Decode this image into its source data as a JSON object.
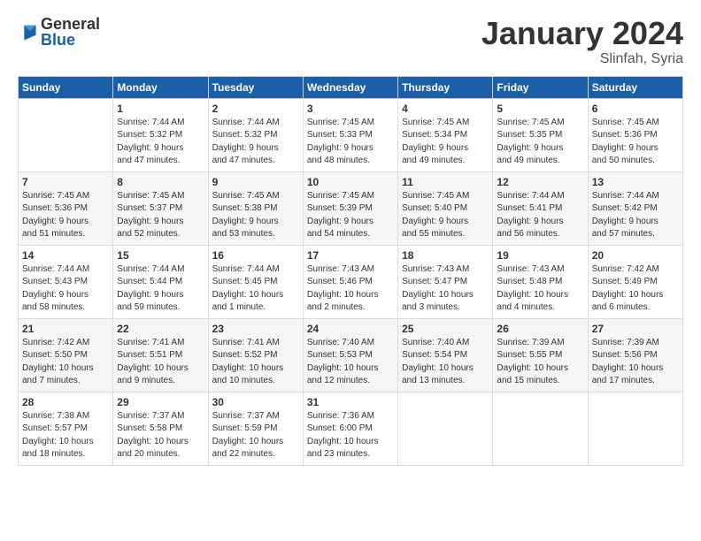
{
  "logo": {
    "general": "General",
    "blue": "Blue"
  },
  "header": {
    "month": "January 2024",
    "location": "Slinfah, Syria"
  },
  "days_of_week": [
    "Sunday",
    "Monday",
    "Tuesday",
    "Wednesday",
    "Thursday",
    "Friday",
    "Saturday"
  ],
  "weeks": [
    [
      {
        "day": "",
        "info": ""
      },
      {
        "day": "1",
        "info": "Sunrise: 7:44 AM\nSunset: 5:32 PM\nDaylight: 9 hours\nand 47 minutes."
      },
      {
        "day": "2",
        "info": "Sunrise: 7:44 AM\nSunset: 5:32 PM\nDaylight: 9 hours\nand 47 minutes."
      },
      {
        "day": "3",
        "info": "Sunrise: 7:45 AM\nSunset: 5:33 PM\nDaylight: 9 hours\nand 48 minutes."
      },
      {
        "day": "4",
        "info": "Sunrise: 7:45 AM\nSunset: 5:34 PM\nDaylight: 9 hours\nand 49 minutes."
      },
      {
        "day": "5",
        "info": "Sunrise: 7:45 AM\nSunset: 5:35 PM\nDaylight: 9 hours\nand 49 minutes."
      },
      {
        "day": "6",
        "info": "Sunrise: 7:45 AM\nSunset: 5:36 PM\nDaylight: 9 hours\nand 50 minutes."
      }
    ],
    [
      {
        "day": "7",
        "info": "Sunrise: 7:45 AM\nSunset: 5:36 PM\nDaylight: 9 hours\nand 51 minutes."
      },
      {
        "day": "8",
        "info": "Sunrise: 7:45 AM\nSunset: 5:37 PM\nDaylight: 9 hours\nand 52 minutes."
      },
      {
        "day": "9",
        "info": "Sunrise: 7:45 AM\nSunset: 5:38 PM\nDaylight: 9 hours\nand 53 minutes."
      },
      {
        "day": "10",
        "info": "Sunrise: 7:45 AM\nSunset: 5:39 PM\nDaylight: 9 hours\nand 54 minutes."
      },
      {
        "day": "11",
        "info": "Sunrise: 7:45 AM\nSunset: 5:40 PM\nDaylight: 9 hours\nand 55 minutes."
      },
      {
        "day": "12",
        "info": "Sunrise: 7:44 AM\nSunset: 5:41 PM\nDaylight: 9 hours\nand 56 minutes."
      },
      {
        "day": "13",
        "info": "Sunrise: 7:44 AM\nSunset: 5:42 PM\nDaylight: 9 hours\nand 57 minutes."
      }
    ],
    [
      {
        "day": "14",
        "info": "Sunrise: 7:44 AM\nSunset: 5:43 PM\nDaylight: 9 hours\nand 58 minutes."
      },
      {
        "day": "15",
        "info": "Sunrise: 7:44 AM\nSunset: 5:44 PM\nDaylight: 9 hours\nand 59 minutes."
      },
      {
        "day": "16",
        "info": "Sunrise: 7:44 AM\nSunset: 5:45 PM\nDaylight: 10 hours\nand 1 minute."
      },
      {
        "day": "17",
        "info": "Sunrise: 7:43 AM\nSunset: 5:46 PM\nDaylight: 10 hours\nand 2 minutes."
      },
      {
        "day": "18",
        "info": "Sunrise: 7:43 AM\nSunset: 5:47 PM\nDaylight: 10 hours\nand 3 minutes."
      },
      {
        "day": "19",
        "info": "Sunrise: 7:43 AM\nSunset: 5:48 PM\nDaylight: 10 hours\nand 4 minutes."
      },
      {
        "day": "20",
        "info": "Sunrise: 7:42 AM\nSunset: 5:49 PM\nDaylight: 10 hours\nand 6 minutes."
      }
    ],
    [
      {
        "day": "21",
        "info": "Sunrise: 7:42 AM\nSunset: 5:50 PM\nDaylight: 10 hours\nand 7 minutes."
      },
      {
        "day": "22",
        "info": "Sunrise: 7:41 AM\nSunset: 5:51 PM\nDaylight: 10 hours\nand 9 minutes."
      },
      {
        "day": "23",
        "info": "Sunrise: 7:41 AM\nSunset: 5:52 PM\nDaylight: 10 hours\nand 10 minutes."
      },
      {
        "day": "24",
        "info": "Sunrise: 7:40 AM\nSunset: 5:53 PM\nDaylight: 10 hours\nand 12 minutes."
      },
      {
        "day": "25",
        "info": "Sunrise: 7:40 AM\nSunset: 5:54 PM\nDaylight: 10 hours\nand 13 minutes."
      },
      {
        "day": "26",
        "info": "Sunrise: 7:39 AM\nSunset: 5:55 PM\nDaylight: 10 hours\nand 15 minutes."
      },
      {
        "day": "27",
        "info": "Sunrise: 7:39 AM\nSunset: 5:56 PM\nDaylight: 10 hours\nand 17 minutes."
      }
    ],
    [
      {
        "day": "28",
        "info": "Sunrise: 7:38 AM\nSunset: 5:57 PM\nDaylight: 10 hours\nand 18 minutes."
      },
      {
        "day": "29",
        "info": "Sunrise: 7:37 AM\nSunset: 5:58 PM\nDaylight: 10 hours\nand 20 minutes."
      },
      {
        "day": "30",
        "info": "Sunrise: 7:37 AM\nSunset: 5:59 PM\nDaylight: 10 hours\nand 22 minutes."
      },
      {
        "day": "31",
        "info": "Sunrise: 7:36 AM\nSunset: 6:00 PM\nDaylight: 10 hours\nand 23 minutes."
      },
      {
        "day": "",
        "info": ""
      },
      {
        "day": "",
        "info": ""
      },
      {
        "day": "",
        "info": ""
      }
    ]
  ]
}
